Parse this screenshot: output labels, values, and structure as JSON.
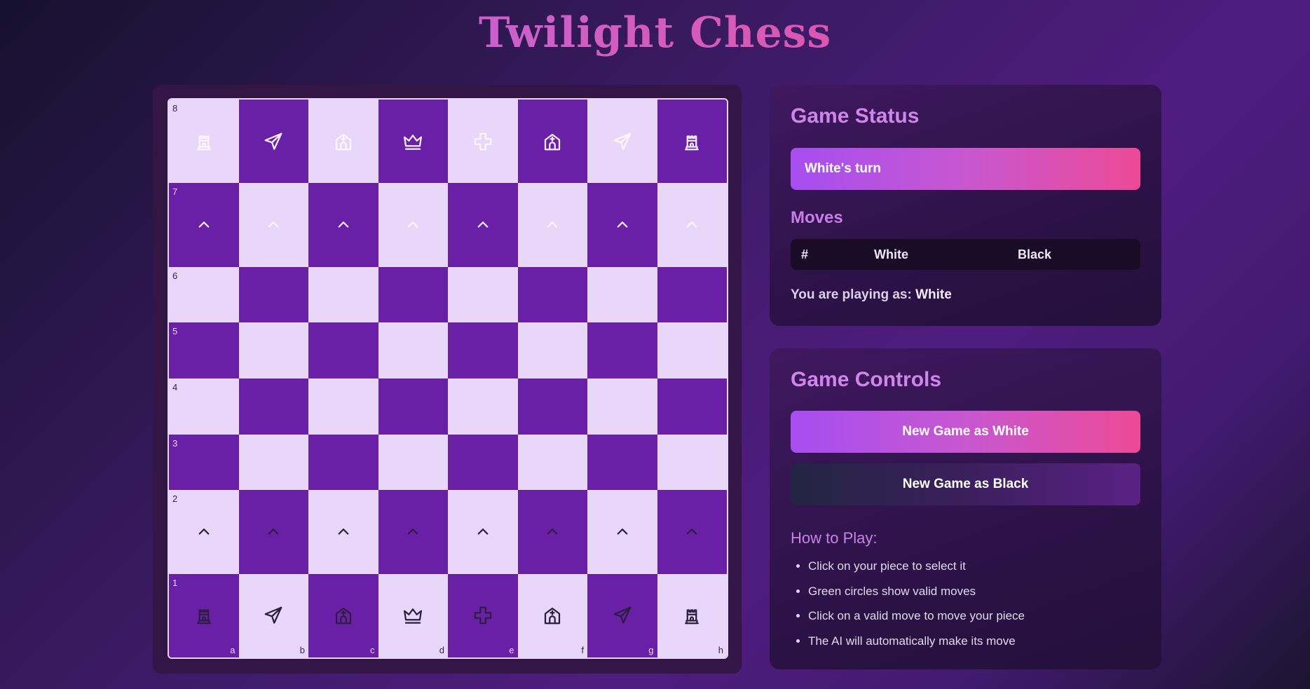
{
  "app": {
    "title": "Twilight Chess"
  },
  "board": {
    "rank_labels": [
      "8",
      "7",
      "6",
      "5",
      "4",
      "3",
      "2",
      "1"
    ],
    "file_labels": [
      "a",
      "b",
      "c",
      "d",
      "e",
      "f",
      "g",
      "h"
    ],
    "rows": [
      [
        "b-rook",
        "b-knight",
        "b-bishop",
        "b-queen",
        "b-king",
        "b-bishop",
        "b-knight",
        "b-rook"
      ],
      [
        "b-pawn",
        "b-pawn",
        "b-pawn",
        "b-pawn",
        "b-pawn",
        "b-pawn",
        "b-pawn",
        "b-pawn"
      ],
      [
        "",
        "",
        "",
        "",
        "",
        "",
        "",
        ""
      ],
      [
        "",
        "",
        "",
        "",
        "",
        "",
        "",
        ""
      ],
      [
        "",
        "",
        "",
        "",
        "",
        "",
        "",
        ""
      ],
      [
        "",
        "",
        "",
        "",
        "",
        "",
        "",
        ""
      ],
      [
        "w-pawn",
        "w-pawn",
        "w-pawn",
        "w-pawn",
        "w-pawn",
        "w-pawn",
        "w-pawn",
        "w-pawn"
      ],
      [
        "w-rook",
        "w-knight",
        "w-bishop",
        "w-queen",
        "w-king",
        "w-bishop",
        "w-knight",
        "w-rook"
      ]
    ],
    "colors": {
      "light": "#e8d7f8",
      "dark": "#6a20a6"
    }
  },
  "status": {
    "heading": "Game Status",
    "turn": "White's turn",
    "moves_heading": "Moves",
    "moves_columns": [
      "#",
      "White",
      "Black"
    ],
    "playing_as_label": "You are playing as:",
    "playing_as_value": "White"
  },
  "controls": {
    "heading": "Game Controls",
    "new_white_label": "New Game as White",
    "new_black_label": "New Game as Black",
    "howto_heading": "How to Play:",
    "rules": [
      "Click on your piece to select it",
      "Green circles show valid moves",
      "Click on a valid move to move your piece",
      "The AI will automatically make its move"
    ]
  }
}
